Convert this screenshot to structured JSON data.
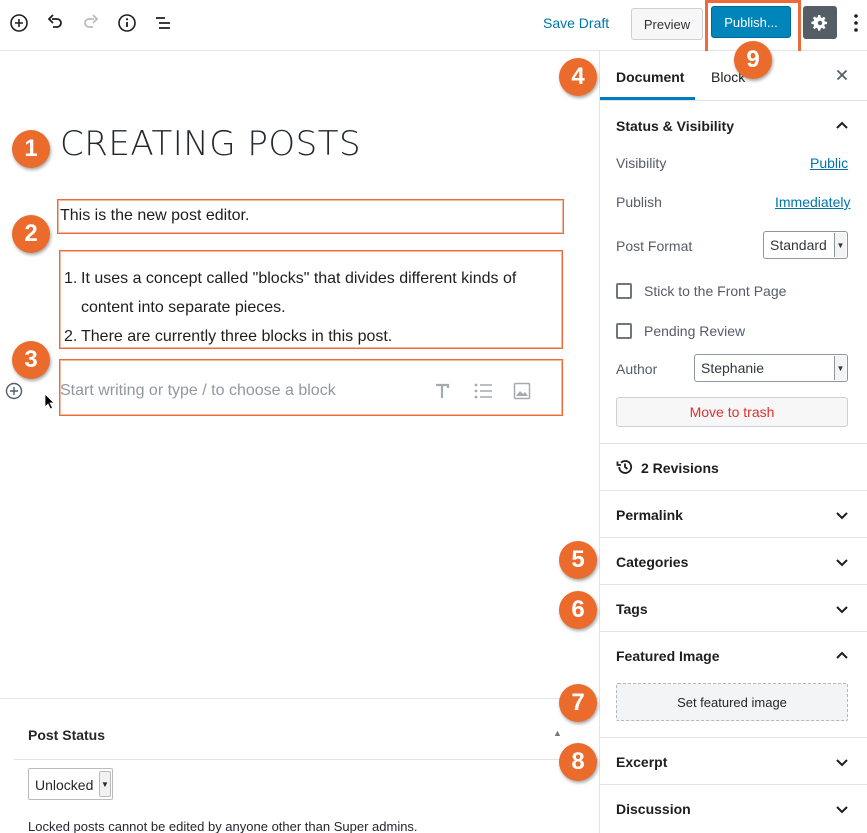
{
  "toolbar": {
    "save_draft": "Save Draft",
    "preview": "Preview",
    "publish": "Publish..."
  },
  "editor": {
    "title": "CREATING POSTS",
    "paragraph": "This is the new post editor.",
    "list": {
      "item1_num": "1.",
      "item1_line1": "It uses a concept called \"blocks\" that divides different kinds of",
      "item1_line2": "content into separate pieces.",
      "item2_num": "2.",
      "item2": "There are currently three blocks in this post."
    },
    "placeholder": "Start writing or type / to choose a block"
  },
  "meta_box": {
    "title": "Post Status",
    "select_value": "Unlocked",
    "note": "Locked posts cannot be edited by anyone other than Super admins."
  },
  "sidebar": {
    "tabs": {
      "document": "Document",
      "block": "Block"
    },
    "status_visibility": {
      "title": "Status & Visibility",
      "visibility_label": "Visibility",
      "visibility_value": "Public",
      "publish_label": "Publish",
      "publish_value": "Immediately",
      "post_format_label": "Post Format",
      "post_format_value": "Standard",
      "sticky_label": "Stick to the Front Page",
      "pending_label": "Pending Review",
      "author_label": "Author",
      "author_value": "Stephanie",
      "trash": "Move to trash"
    },
    "revisions": "2 Revisions",
    "permalink": "Permalink",
    "categories": "Categories",
    "tags": "Tags",
    "featured_image": {
      "title": "Featured Image",
      "button": "Set featured image"
    },
    "excerpt": "Excerpt",
    "discussion": "Discussion"
  },
  "badges": [
    "1",
    "2",
    "3",
    "4",
    "5",
    "6",
    "7",
    "8",
    "9"
  ],
  "colors": {
    "accent": "#0085ba",
    "badge": "#ea6b2b",
    "highlight": "#ed6a3a"
  }
}
